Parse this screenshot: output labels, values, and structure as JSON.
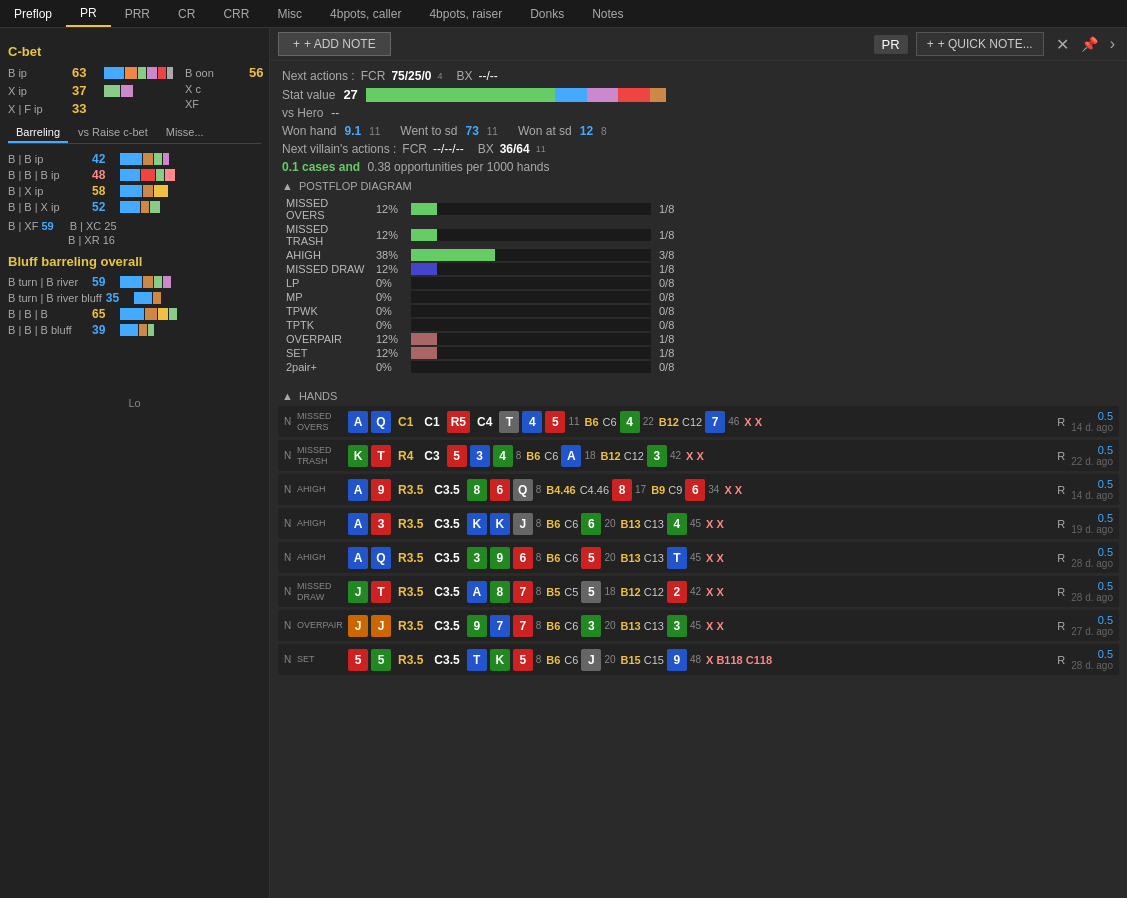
{
  "nav": {
    "items": [
      {
        "label": "Preflop",
        "active": false
      },
      {
        "label": "PR",
        "active": true
      },
      {
        "label": "PRR",
        "active": false
      },
      {
        "label": "CR",
        "active": false
      },
      {
        "label": "CRR",
        "active": false
      },
      {
        "label": "Misc",
        "active": false
      },
      {
        "label": "4bpots, caller",
        "active": false
      },
      {
        "label": "4bpots, raiser",
        "active": false
      },
      {
        "label": "Donks",
        "active": false
      },
      {
        "label": "Notes",
        "active": false
      }
    ]
  },
  "left_panel": {
    "cbet_header": "C-bet",
    "rows": [
      {
        "label": "B ip",
        "value": "63"
      },
      {
        "label": "X ip",
        "value": "37"
      },
      {
        "label": "X | F ip",
        "value": "33"
      }
    ],
    "boon_label": "B oon",
    "boon_value": "56",
    "x_label": "X c",
    "xf_label": "XF",
    "tabs": [
      "Barreling",
      "vs Raise c-bet",
      "Misse..."
    ],
    "active_tab": "Barreling",
    "barreling_rows": [
      {
        "label": "B | B ip",
        "value": "42",
        "color": "cyan"
      },
      {
        "label": "B | B | B ip",
        "value": "48",
        "color": "pink"
      },
      {
        "label": "B | X ip",
        "value": "58",
        "color": "yellow"
      },
      {
        "label": "B | B | X ip",
        "value": "52",
        "color": "cyan"
      }
    ],
    "extra_rows": [
      {
        "label1": "B | XF",
        "val1": "59",
        "label2": "B | XC",
        "val2": "25"
      },
      {
        "label1": "",
        "val1": "",
        "label2": "B | XR",
        "val2": "16"
      }
    ],
    "bluff_header": "Bluff barreling overall",
    "bluff_rows": [
      {
        "label": "B turn | B river",
        "value": "59",
        "color": "cyan"
      },
      {
        "label": "B turn | B river bluff",
        "value": "35",
        "color": "cyan"
      },
      {
        "label": "B | B | B",
        "value": "65",
        "color": "yellow"
      },
      {
        "label": "B | B | B bluff",
        "value": "39",
        "color": "cyan"
      }
    ]
  },
  "main_panel": {
    "add_note_label": "+ ADD NOTE",
    "pr_label": "PR",
    "quick_note_label": "+ QUICK NOTE...",
    "next_actions_label": "Next actions :",
    "fcr_label": "FCR",
    "fcr_value": "75/25/0",
    "fcr_sub": "4",
    "bx_label": "BX",
    "bx_value": "--/--",
    "stat_value_label": "Stat value",
    "stat_value": "27",
    "vs_hero_label": "vs Hero",
    "vs_hero_value": "--",
    "won_hand_label": "Won hand",
    "won_hand_value": "9.1",
    "won_hand_sub": "11",
    "went_to_sd_label": "Went to sd",
    "went_to_sd_value": "73",
    "went_to_sd_sub": "11",
    "won_at_sd_label": "Won at sd",
    "won_at_sd_value": "12",
    "won_at_sd_sub": "8",
    "next_villain_label": "Next villain's actions :",
    "nv_fcr_label": "FCR",
    "nv_fcr_value": "--/--/--",
    "nv_bx_label": "BX",
    "nv_bx_value": "36/64",
    "nv_bx_sub": "11",
    "cases_text": "0.1 cases and",
    "opps_text": "0.38 opportunities per 1000 hands",
    "postflop_header": "POSTFLOP DIAGRAM",
    "postflop_rows": [
      {
        "label": "MISSED OVERS",
        "pct": "12%",
        "bar_pct": 12,
        "count": "1/8"
      },
      {
        "label": "MISSED TRASH",
        "pct": "12%",
        "bar_pct": 12,
        "count": "1/8"
      },
      {
        "label": "AHIGH",
        "pct": "38%",
        "bar_pct": 38,
        "count": "3/8"
      },
      {
        "label": "MISSED DRAW",
        "pct": "12%",
        "bar_pct": 12,
        "count": "1/8"
      },
      {
        "label": "LP",
        "pct": "0%",
        "bar_pct": 0,
        "count": "0/8"
      },
      {
        "label": "MP",
        "pct": "0%",
        "bar_pct": 0,
        "count": "0/8"
      },
      {
        "label": "TPWK",
        "pct": "0%",
        "bar_pct": 0,
        "count": "0/8"
      },
      {
        "label": "TPTK",
        "pct": "0%",
        "bar_pct": 0,
        "count": "0/8"
      },
      {
        "label": "OVERPAIR",
        "pct": "12%",
        "bar_pct": 12,
        "count": "1/8"
      },
      {
        "label": "SET",
        "pct": "12%",
        "bar_pct": 12,
        "count": "1/8"
      },
      {
        "label": "2pair+",
        "pct": "0%",
        "bar_pct": 0,
        "count": "0/8"
      }
    ],
    "hands_header": "HANDS",
    "hands": [
      {
        "n": "N",
        "type": "MISSED\nOVERS",
        "cards": [
          {
            "val": "A",
            "cls": "card-blue"
          },
          {
            "val": "Q",
            "cls": "card-blue"
          },
          {
            "val": "C1",
            "cls": "card-yellow-text"
          },
          {
            "val": "C1",
            "cls": "card-white"
          },
          {
            "val": "R5",
            "cls": "card-red"
          },
          {
            "val": "C4",
            "cls": "card-white"
          },
          {
            "val": "T",
            "cls": "card-gray"
          },
          {
            "val": "4",
            "cls": "card-blue"
          },
          {
            "val": "5",
            "cls": "card-red"
          },
          {
            "val": "11",
            "cls": "card-white hand-num"
          }
        ],
        "b6c6": "B6 C6",
        "num1": "4",
        "num1cls": "card-green",
        "val1": "22",
        "b12c12": "B12 C12",
        "num2": "7",
        "num2cls": "card-blue",
        "val2": "46",
        "xx": "X X",
        "r": "R",
        "oop": "0.5",
        "time": "14 d. ago"
      },
      {
        "n": "N",
        "type": "MISSED\nTRASH",
        "cards": [
          {
            "val": "K",
            "cls": "card-green"
          },
          {
            "val": "T",
            "cls": "card-red"
          },
          {
            "val": "R4",
            "cls": "card-yellow-text"
          },
          {
            "val": "C3",
            "cls": "card-white"
          },
          {
            "val": "5",
            "cls": "card-red"
          },
          {
            "val": "3",
            "cls": "card-blue"
          },
          {
            "val": "4",
            "cls": "card-green"
          },
          {
            "val": "8",
            "cls": "hand-num card-white"
          }
        ],
        "b6c6": "B6 C6",
        "num1": "A",
        "num1cls": "card-blue",
        "val1": "18",
        "b12c12": "B12 C12",
        "num2": "3",
        "num2cls": "card-green",
        "val2": "42",
        "xx": "X X",
        "r": "R",
        "oop": "0.5",
        "time": "22 d. ago"
      },
      {
        "n": "N",
        "type": "AHIGH",
        "cards": [
          {
            "val": "A",
            "cls": "card-blue"
          },
          {
            "val": "9",
            "cls": "card-red"
          },
          {
            "val": "R3.5",
            "cls": "card-yellow-text"
          },
          {
            "val": "C3.5",
            "cls": "card-white"
          },
          {
            "val": "8",
            "cls": "card-green"
          },
          {
            "val": "6",
            "cls": "card-red"
          },
          {
            "val": "Q",
            "cls": "card-gray"
          },
          {
            "val": "8",
            "cls": "hand-num card-white"
          }
        ],
        "b4c4": "B4.46 C4.46",
        "num1": "8",
        "num1cls": "card-red",
        "val1": "17",
        "b12c12": "B9 C9",
        "num2": "6",
        "num2cls": "card-red",
        "val2": "34",
        "xx": "X X",
        "r": "R",
        "oop": "0.5",
        "time": "14 d. ago"
      },
      {
        "n": "N",
        "type": "AHIGH",
        "cards": [
          {
            "val": "A",
            "cls": "card-blue"
          },
          {
            "val": "3",
            "cls": "card-red"
          },
          {
            "val": "R3.5",
            "cls": "card-yellow-text"
          },
          {
            "val": "C3.5",
            "cls": "card-white"
          },
          {
            "val": "K",
            "cls": "card-blue"
          },
          {
            "val": "K",
            "cls": "card-blue"
          },
          {
            "val": "J",
            "cls": "card-gray"
          },
          {
            "val": "8",
            "cls": "hand-num card-white"
          }
        ],
        "b6c6": "B6 C6",
        "num1": "6",
        "num1cls": "card-green",
        "val1": "20",
        "b12c12": "B13 C13",
        "num2": "4",
        "num2cls": "card-green",
        "val2": "45",
        "xx": "X X",
        "r": "R",
        "oop": "0.5",
        "time": "19 d. ago"
      },
      {
        "n": "N",
        "type": "AHIGH",
        "cards": [
          {
            "val": "A",
            "cls": "card-blue"
          },
          {
            "val": "Q",
            "cls": "card-blue"
          },
          {
            "val": "R3.5",
            "cls": "card-yellow-text"
          },
          {
            "val": "C3.5",
            "cls": "card-white"
          },
          {
            "val": "3",
            "cls": "card-green"
          },
          {
            "val": "9",
            "cls": "card-green"
          },
          {
            "val": "6",
            "cls": "card-red"
          },
          {
            "val": "8",
            "cls": "hand-num card-white"
          }
        ],
        "b6c6": "B6 C6",
        "num1": "5",
        "num1cls": "card-red",
        "val1": "20",
        "b12c12": "B13 C13",
        "num2": "T",
        "num2cls": "card-blue",
        "val2": "45",
        "xx": "X X",
        "r": "R",
        "oop": "0.5",
        "time": "28 d. ago"
      },
      {
        "n": "N",
        "type": "MISSED\nDRAW",
        "cards": [
          {
            "val": "J",
            "cls": "card-green"
          },
          {
            "val": "T",
            "cls": "card-red"
          },
          {
            "val": "R3.5",
            "cls": "card-yellow-text"
          },
          {
            "val": "C3.5",
            "cls": "card-white"
          },
          {
            "val": "A",
            "cls": "card-blue"
          },
          {
            "val": "8",
            "cls": "card-green"
          },
          {
            "val": "7",
            "cls": "card-red"
          },
          {
            "val": "8",
            "cls": "hand-num card-white"
          }
        ],
        "b6c6": "B5 C5",
        "num1": "5",
        "num1cls": "card-gray",
        "val1": "18",
        "b12c12": "B12 C12",
        "num2": "2",
        "num2cls": "card-red",
        "val2": "42",
        "xx": "X X",
        "r": "R",
        "oop": "0.5",
        "time": "28 d. ago"
      },
      {
        "n": "N",
        "type": "OVERPAIR",
        "cards": [
          {
            "val": "J",
            "cls": "card-orange"
          },
          {
            "val": "J",
            "cls": "card-orange"
          },
          {
            "val": "R3.5",
            "cls": "card-yellow-text"
          },
          {
            "val": "C3.5",
            "cls": "card-white"
          },
          {
            "val": "9",
            "cls": "card-green"
          },
          {
            "val": "7",
            "cls": "card-blue"
          },
          {
            "val": "7",
            "cls": "card-red"
          },
          {
            "val": "8",
            "cls": "hand-num card-white"
          }
        ],
        "b6c6": "B6 C6",
        "num1": "3",
        "num1cls": "card-green",
        "val1": "20",
        "b12c12": "B13 C13",
        "num2": "3",
        "num2cls": "card-green",
        "val2": "45",
        "xx": "X X",
        "r": "R",
        "oop": "0.5",
        "time": "27 d. ago"
      },
      {
        "n": "N",
        "type": "SET",
        "cards": [
          {
            "val": "5",
            "cls": "card-red"
          },
          {
            "val": "5",
            "cls": "card-green"
          },
          {
            "val": "R3.5",
            "cls": "card-yellow-text"
          },
          {
            "val": "C3.5",
            "cls": "card-white"
          },
          {
            "val": "T",
            "cls": "card-blue"
          },
          {
            "val": "K",
            "cls": "card-green"
          },
          {
            "val": "5",
            "cls": "card-red"
          },
          {
            "val": "8",
            "cls": "hand-num card-white"
          }
        ],
        "b6c6": "B6 C6",
        "num1": "J",
        "num1cls": "card-gray",
        "val1": "20",
        "b12c12": "B15 C15",
        "num2": "9",
        "num2cls": "card-blue",
        "val2": "48",
        "xx": "X B118 C118",
        "r": "R",
        "oop": "0.5",
        "time": "28 d. ago"
      }
    ]
  }
}
